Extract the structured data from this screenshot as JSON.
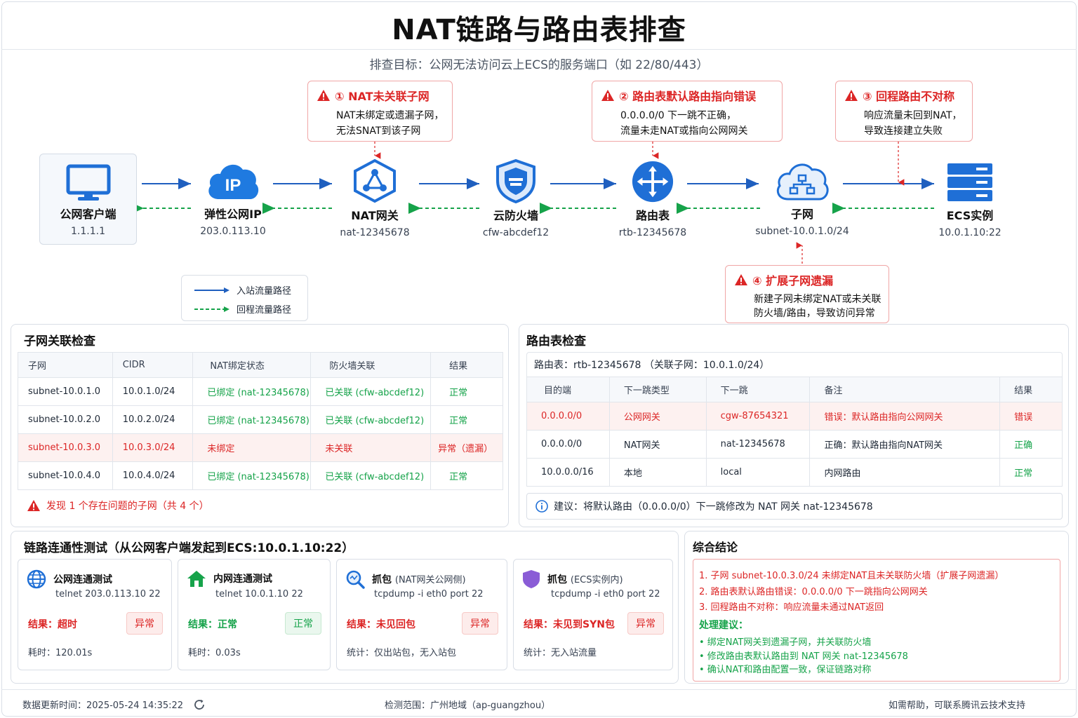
{
  "title": "NAT链路与路由表排查",
  "subtitle": "排查目标：公网无法访问云上ECS的服务端口（如 22/80/443）",
  "nodes": [
    {
      "label": "公网客户端",
      "sub": "1.1.1.1",
      "icon": "monitor-icon"
    },
    {
      "label": "弹性公网IP",
      "sub": "203.0.113.10",
      "icon": "cloud-ip-icon",
      "icon_text": "IP"
    },
    {
      "label": "NAT网关",
      "sub": "nat-12345678",
      "icon": "nat-hexagon-icon"
    },
    {
      "label": "云防火墙",
      "sub": "cfw-abcdef12",
      "icon": "shield-icon"
    },
    {
      "label": "路由表",
      "sub": "rtb-12345678",
      "icon": "router-icon"
    },
    {
      "label": "子网",
      "sub": "subnet-10.0.1.0/24",
      "icon": "cloud-network-icon"
    },
    {
      "label": "ECS实例",
      "sub": "10.0.1.10:22",
      "icon": "server-icon"
    }
  ],
  "callouts": [
    {
      "title": "① NAT未关联子网",
      "lines": [
        "NAT未绑定或遗漏子网，",
        "无法SNAT到该子网"
      ]
    },
    {
      "title": "② 路由表默认路由指向错误",
      "lines": [
        "0.0.0.0/0 下一跳不正确，",
        "流量未走NAT或指向公网网关"
      ]
    },
    {
      "title": "③ 回程路由不对称",
      "lines": [
        "响应流量未回到NAT，",
        "导致连接建立失败"
      ]
    },
    {
      "title": "④ 扩展子网遗漏",
      "lines": [
        "新建子网未绑定NAT或未关联",
        "防火墙/路由，导致访问异常"
      ]
    }
  ],
  "legend": {
    "inbound": "入站流量路径",
    "return": "回程流量路径"
  },
  "colors": {
    "inbound": "#1f5fbf",
    "return": "#16a34a",
    "error": "#dc2626",
    "accent": "#1677ff"
  },
  "subnet_check": {
    "title": "子网关联检查",
    "headers": [
      "子网",
      "CIDR",
      "NAT绑定状态",
      "防火墙关联",
      "结果"
    ],
    "rows": [
      [
        "subnet-10.0.1.0",
        "10.0.1.0/24",
        "已绑定 (nat-12345678)",
        "已关联 (cfw-abcdef12)",
        "正常"
      ],
      [
        "subnet-10.0.2.0",
        "10.0.2.0/24",
        "已绑定 (nat-12345678)",
        "已关联 (cfw-abcdef12)",
        "正常"
      ],
      [
        "subnet-10.0.3.0",
        "10.0.3.0/24",
        "未绑定",
        "未关联",
        "异常（遗漏）"
      ],
      [
        "subnet-10.0.4.0",
        "10.0.4.0/24",
        "已绑定 (nat-12345678)",
        "已关联 (cfw-abcdef12)",
        "正常"
      ]
    ],
    "summary": "发现 1 个存在问题的子网（共 4 个）"
  },
  "route_check": {
    "title": "路由表检查",
    "table_label": "路由表：rtb-12345678 （关联子网：10.0.1.0/24）",
    "headers": [
      "目的端",
      "下一跳类型",
      "下一跳",
      "备注",
      "结果"
    ],
    "rows": [
      [
        "0.0.0.0/0",
        "公网网关",
        "cgw-87654321",
        "错误：默认路由指向公网网关",
        "错误"
      ],
      [
        "0.0.0.0/0",
        "NAT网关",
        "nat-12345678",
        "正确：默认路由指向NAT网关",
        "正确"
      ],
      [
        "10.0.0.0/16",
        "本地",
        "local",
        "内网路由",
        "正常"
      ]
    ],
    "advice": "建议：将默认路由（0.0.0.0/0）下一跳修改为 NAT 网关 nat-12345678"
  },
  "connectivity": {
    "title": "链路连通性测试（从公网客户端发起到ECS:10.0.1.10:22）",
    "cards": [
      {
        "title": "公网连通测试",
        "title_sub": "",
        "cmd": "telnet 203.0.113.10 22",
        "result": "结果：超时",
        "badge": "异常",
        "stat": "耗时：120.01s"
      },
      {
        "title": "内网连通测试",
        "title_sub": "",
        "cmd": "telnet 10.0.1.10 22",
        "result": "结果：正常",
        "badge": "正常",
        "stat": "耗时：0.03s"
      },
      {
        "title": "抓包",
        "title_sub": "(NAT网关公网侧)",
        "cmd": "tcpdump -i eth0 port 22",
        "result": "结果：未见回包",
        "badge": "异常",
        "stat": "统计：仅出站包，无入站包"
      },
      {
        "title": "抓包",
        "title_sub": "(ECS实例内)",
        "cmd": "tcpdump -i eth0 port 22",
        "result": "结果：未见到SYN包",
        "badge": "异常",
        "stat": "统计：无入站流量"
      }
    ]
  },
  "conclusion": {
    "title": "综合结论",
    "items": [
      "1. 子网 subnet-10.0.3.0/24 未绑定NAT且未关联防火墙（扩展子网遗漏）",
      "2. 路由表默认路由错误：0.0.0.0/0 下一跳指向公网网关",
      "3. 回程路由不对称：响应流量未通过NAT返回"
    ],
    "suggest_title": "处理建议：",
    "suggestions": [
      "• 绑定NAT网关到遗漏子网，并关联防火墙",
      "• 修改路由表默认路由到 NAT 网关 nat-12345678",
      "• 确认NAT和路由配置一致，保证链路对称"
    ]
  },
  "footer": {
    "updated": "数据更新时间：2025-05-24 14:35:22",
    "scope": "检测范围：广州地域（ap-guangzhou）",
    "help": "如需帮助，可联系腾讯云技术支持"
  }
}
